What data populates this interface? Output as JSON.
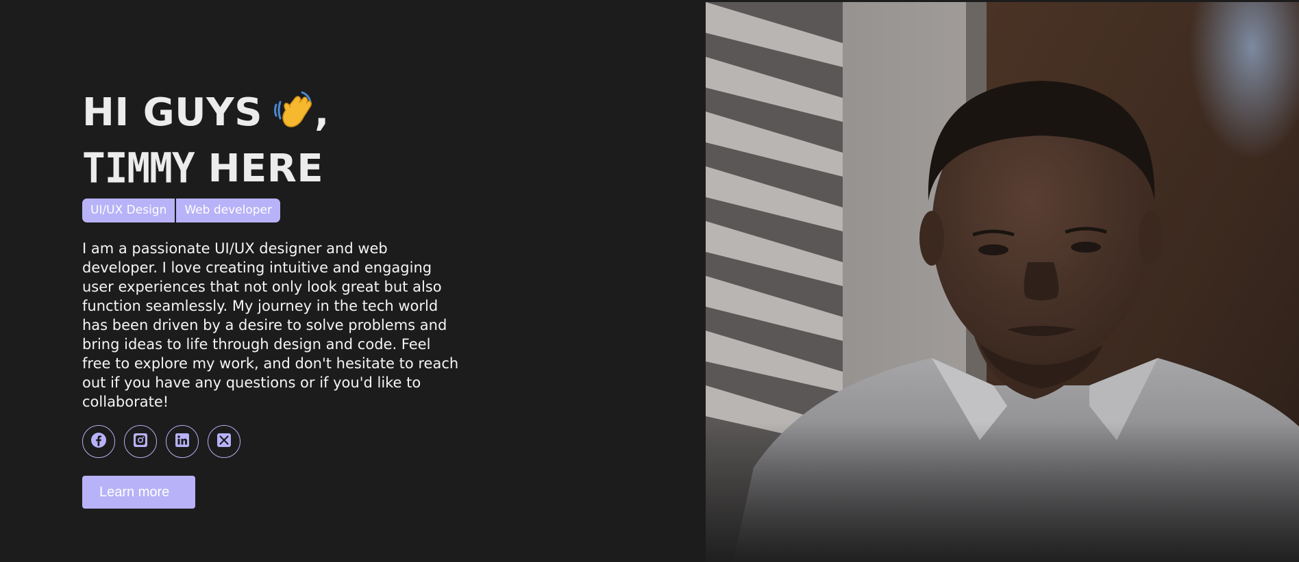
{
  "hero": {
    "greeting": "HI GUYS",
    "greeting_suffix": ",",
    "name": "TIMMY",
    "name_suffix": "HERE",
    "wave_icon": "waving-hand-emoji"
  },
  "tags": [
    "UI/UX Design",
    "Web developer"
  ],
  "bio": "I am a passionate UI/UX designer and web developer. I love creating intuitive and engaging user experiences that not only look great but also function seamlessly. My journey in the tech world has been driven by a desire to solve problems and bring ideas to life through design and code. Feel free to explore my work, and don't hesitate to reach out if you have any questions or if you'd like to collaborate!",
  "socials": [
    {
      "name": "facebook",
      "icon": "facebook-icon"
    },
    {
      "name": "instagram",
      "icon": "instagram-icon"
    },
    {
      "name": "linkedin",
      "icon": "linkedin-icon"
    },
    {
      "name": "x",
      "icon": "x-icon"
    }
  ],
  "cta": {
    "label": "Learn more"
  },
  "photo": {
    "subject": "portrait-photo"
  },
  "colors": {
    "background": "#1c1c1c",
    "accent": "#b8b2f8",
    "text": "#ececec"
  }
}
